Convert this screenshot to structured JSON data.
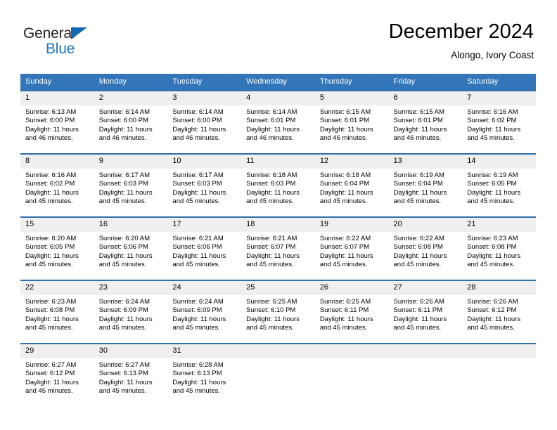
{
  "brand": {
    "name_part1": "General",
    "name_part2": "Blue",
    "flag_icon": "triangle-flag-icon"
  },
  "header": {
    "title": "December 2024",
    "subtitle": "Alongo, Ivory Coast"
  },
  "colors": {
    "header_blue": "#3275b8",
    "row_divider_blue": "#2f6fae",
    "daynum_background": "#efefef",
    "brand_blue": "#1b75bb",
    "text": "#000000"
  },
  "weekday_headers": [
    "Sunday",
    "Monday",
    "Tuesday",
    "Wednesday",
    "Thursday",
    "Friday",
    "Saturday"
  ],
  "weeks": [
    [
      {
        "day": "1",
        "sunrise": "Sunrise: 6:13 AM",
        "sunset": "Sunset: 6:00 PM",
        "daylight": "Daylight: 11 hours and 46 minutes."
      },
      {
        "day": "2",
        "sunrise": "Sunrise: 6:14 AM",
        "sunset": "Sunset: 6:00 PM",
        "daylight": "Daylight: 11 hours and 46 minutes."
      },
      {
        "day": "3",
        "sunrise": "Sunrise: 6:14 AM",
        "sunset": "Sunset: 6:00 PM",
        "daylight": "Daylight: 11 hours and 46 minutes."
      },
      {
        "day": "4",
        "sunrise": "Sunrise: 6:14 AM",
        "sunset": "Sunset: 6:01 PM",
        "daylight": "Daylight: 11 hours and 46 minutes."
      },
      {
        "day": "5",
        "sunrise": "Sunrise: 6:15 AM",
        "sunset": "Sunset: 6:01 PM",
        "daylight": "Daylight: 11 hours and 46 minutes."
      },
      {
        "day": "6",
        "sunrise": "Sunrise: 6:15 AM",
        "sunset": "Sunset: 6:01 PM",
        "daylight": "Daylight: 11 hours and 46 minutes."
      },
      {
        "day": "7",
        "sunrise": "Sunrise: 6:16 AM",
        "sunset": "Sunset: 6:02 PM",
        "daylight": "Daylight: 11 hours and 45 minutes."
      }
    ],
    [
      {
        "day": "8",
        "sunrise": "Sunrise: 6:16 AM",
        "sunset": "Sunset: 6:02 PM",
        "daylight": "Daylight: 11 hours and 45 minutes."
      },
      {
        "day": "9",
        "sunrise": "Sunrise: 6:17 AM",
        "sunset": "Sunset: 6:03 PM",
        "daylight": "Daylight: 11 hours and 45 minutes."
      },
      {
        "day": "10",
        "sunrise": "Sunrise: 6:17 AM",
        "sunset": "Sunset: 6:03 PM",
        "daylight": "Daylight: 11 hours and 45 minutes."
      },
      {
        "day": "11",
        "sunrise": "Sunrise: 6:18 AM",
        "sunset": "Sunset: 6:03 PM",
        "daylight": "Daylight: 11 hours and 45 minutes."
      },
      {
        "day": "12",
        "sunrise": "Sunrise: 6:18 AM",
        "sunset": "Sunset: 6:04 PM",
        "daylight": "Daylight: 11 hours and 45 minutes."
      },
      {
        "day": "13",
        "sunrise": "Sunrise: 6:19 AM",
        "sunset": "Sunset: 6:04 PM",
        "daylight": "Daylight: 11 hours and 45 minutes."
      },
      {
        "day": "14",
        "sunrise": "Sunrise: 6:19 AM",
        "sunset": "Sunset: 6:05 PM",
        "daylight": "Daylight: 11 hours and 45 minutes."
      }
    ],
    [
      {
        "day": "15",
        "sunrise": "Sunrise: 6:20 AM",
        "sunset": "Sunset: 6:05 PM",
        "daylight": "Daylight: 11 hours and 45 minutes."
      },
      {
        "day": "16",
        "sunrise": "Sunrise: 6:20 AM",
        "sunset": "Sunset: 6:06 PM",
        "daylight": "Daylight: 11 hours and 45 minutes."
      },
      {
        "day": "17",
        "sunrise": "Sunrise: 6:21 AM",
        "sunset": "Sunset: 6:06 PM",
        "daylight": "Daylight: 11 hours and 45 minutes."
      },
      {
        "day": "18",
        "sunrise": "Sunrise: 6:21 AM",
        "sunset": "Sunset: 6:07 PM",
        "daylight": "Daylight: 11 hours and 45 minutes."
      },
      {
        "day": "19",
        "sunrise": "Sunrise: 6:22 AM",
        "sunset": "Sunset: 6:07 PM",
        "daylight": "Daylight: 11 hours and 45 minutes."
      },
      {
        "day": "20",
        "sunrise": "Sunrise: 6:22 AM",
        "sunset": "Sunset: 6:08 PM",
        "daylight": "Daylight: 11 hours and 45 minutes."
      },
      {
        "day": "21",
        "sunrise": "Sunrise: 6:23 AM",
        "sunset": "Sunset: 6:08 PM",
        "daylight": "Daylight: 11 hours and 45 minutes."
      }
    ],
    [
      {
        "day": "22",
        "sunrise": "Sunrise: 6:23 AM",
        "sunset": "Sunset: 6:08 PM",
        "daylight": "Daylight: 11 hours and 45 minutes."
      },
      {
        "day": "23",
        "sunrise": "Sunrise: 6:24 AM",
        "sunset": "Sunset: 6:09 PM",
        "daylight": "Daylight: 11 hours and 45 minutes."
      },
      {
        "day": "24",
        "sunrise": "Sunrise: 6:24 AM",
        "sunset": "Sunset: 6:09 PM",
        "daylight": "Daylight: 11 hours and 45 minutes."
      },
      {
        "day": "25",
        "sunrise": "Sunrise: 6:25 AM",
        "sunset": "Sunset: 6:10 PM",
        "daylight": "Daylight: 11 hours and 45 minutes."
      },
      {
        "day": "26",
        "sunrise": "Sunrise: 6:25 AM",
        "sunset": "Sunset: 6:11 PM",
        "daylight": "Daylight: 11 hours and 45 minutes."
      },
      {
        "day": "27",
        "sunrise": "Sunrise: 6:26 AM",
        "sunset": "Sunset: 6:11 PM",
        "daylight": "Daylight: 11 hours and 45 minutes."
      },
      {
        "day": "28",
        "sunrise": "Sunrise: 6:26 AM",
        "sunset": "Sunset: 6:12 PM",
        "daylight": "Daylight: 11 hours and 45 minutes."
      }
    ],
    [
      {
        "day": "29",
        "sunrise": "Sunrise: 6:27 AM",
        "sunset": "Sunset: 6:12 PM",
        "daylight": "Daylight: 11 hours and 45 minutes."
      },
      {
        "day": "30",
        "sunrise": "Sunrise: 6:27 AM",
        "sunset": "Sunset: 6:13 PM",
        "daylight": "Daylight: 11 hours and 45 minutes."
      },
      {
        "day": "31",
        "sunrise": "Sunrise: 6:28 AM",
        "sunset": "Sunset: 6:13 PM",
        "daylight": "Daylight: 11 hours and 45 minutes."
      },
      {
        "day": "",
        "sunrise": "",
        "sunset": "",
        "daylight": ""
      },
      {
        "day": "",
        "sunrise": "",
        "sunset": "",
        "daylight": ""
      },
      {
        "day": "",
        "sunrise": "",
        "sunset": "",
        "daylight": ""
      },
      {
        "day": "",
        "sunrise": "",
        "sunset": "",
        "daylight": ""
      }
    ]
  ]
}
